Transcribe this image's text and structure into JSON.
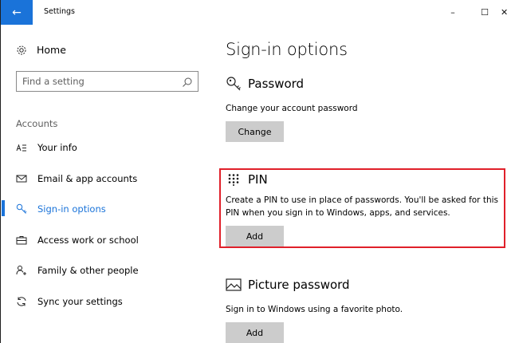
{
  "window": {
    "title": "Settings",
    "controls": {
      "minimize": "–",
      "maximize": "☐",
      "close": "✕"
    },
    "back_glyph": "←",
    "accent": "#1a73d9"
  },
  "sidebar": {
    "home_label": "Home",
    "home_icon": "gear-icon",
    "search_placeholder": "Find a setting",
    "section_label": "Accounts",
    "items": [
      {
        "label": "Your info",
        "icon": "person-list-icon",
        "selected": false
      },
      {
        "label": "Email & app accounts",
        "icon": "mail-icon",
        "selected": false
      },
      {
        "label": "Sign-in options",
        "icon": "key-icon",
        "selected": true
      },
      {
        "label": "Access work or school",
        "icon": "briefcase-icon",
        "selected": false
      },
      {
        "label": "Family & other people",
        "icon": "person-add-icon",
        "selected": false
      },
      {
        "label": "Sync your settings",
        "icon": "sync-icon",
        "selected": false
      }
    ]
  },
  "main": {
    "page_title": "Sign-in options",
    "password": {
      "title": "Password",
      "description": "Change your account password",
      "button": "Change"
    },
    "pin": {
      "title": "PIN",
      "description": "Create a PIN to use in place of passwords. You'll be asked for this PIN when you sign in to Windows, apps, and services.",
      "button": "Add",
      "highlight_color": "#e0202a"
    },
    "picture_password": {
      "title": "Picture password",
      "description": "Sign in to Windows using a favorite photo.",
      "button": "Add"
    }
  }
}
